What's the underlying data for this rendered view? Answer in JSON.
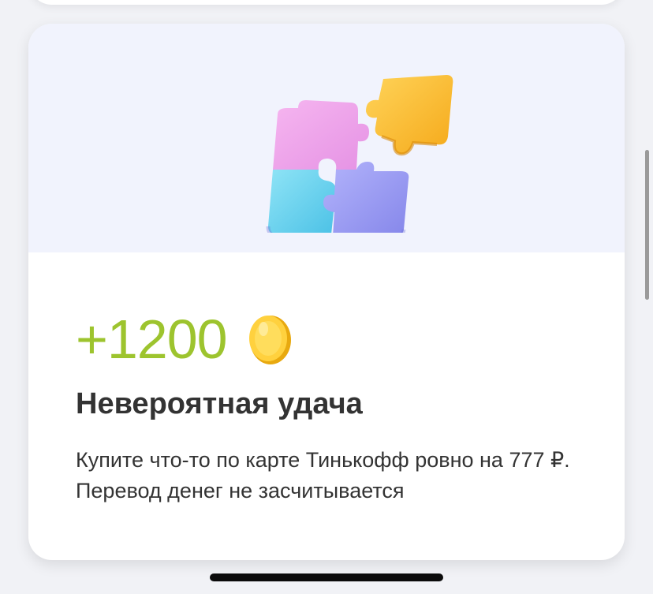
{
  "card": {
    "image_icon": "puzzle-pieces-icon",
    "reward": {
      "amount": "+1200",
      "icon": "coin-icon"
    },
    "title": "Невероятная удача",
    "description": "Купите что-то по карте Тинькофф ровно на 777 ₽. Перевод денег не засчитывается"
  },
  "colors": {
    "reward_green": "#9dc42e",
    "hero_bg": "#f1f3fd",
    "text": "#333333"
  }
}
